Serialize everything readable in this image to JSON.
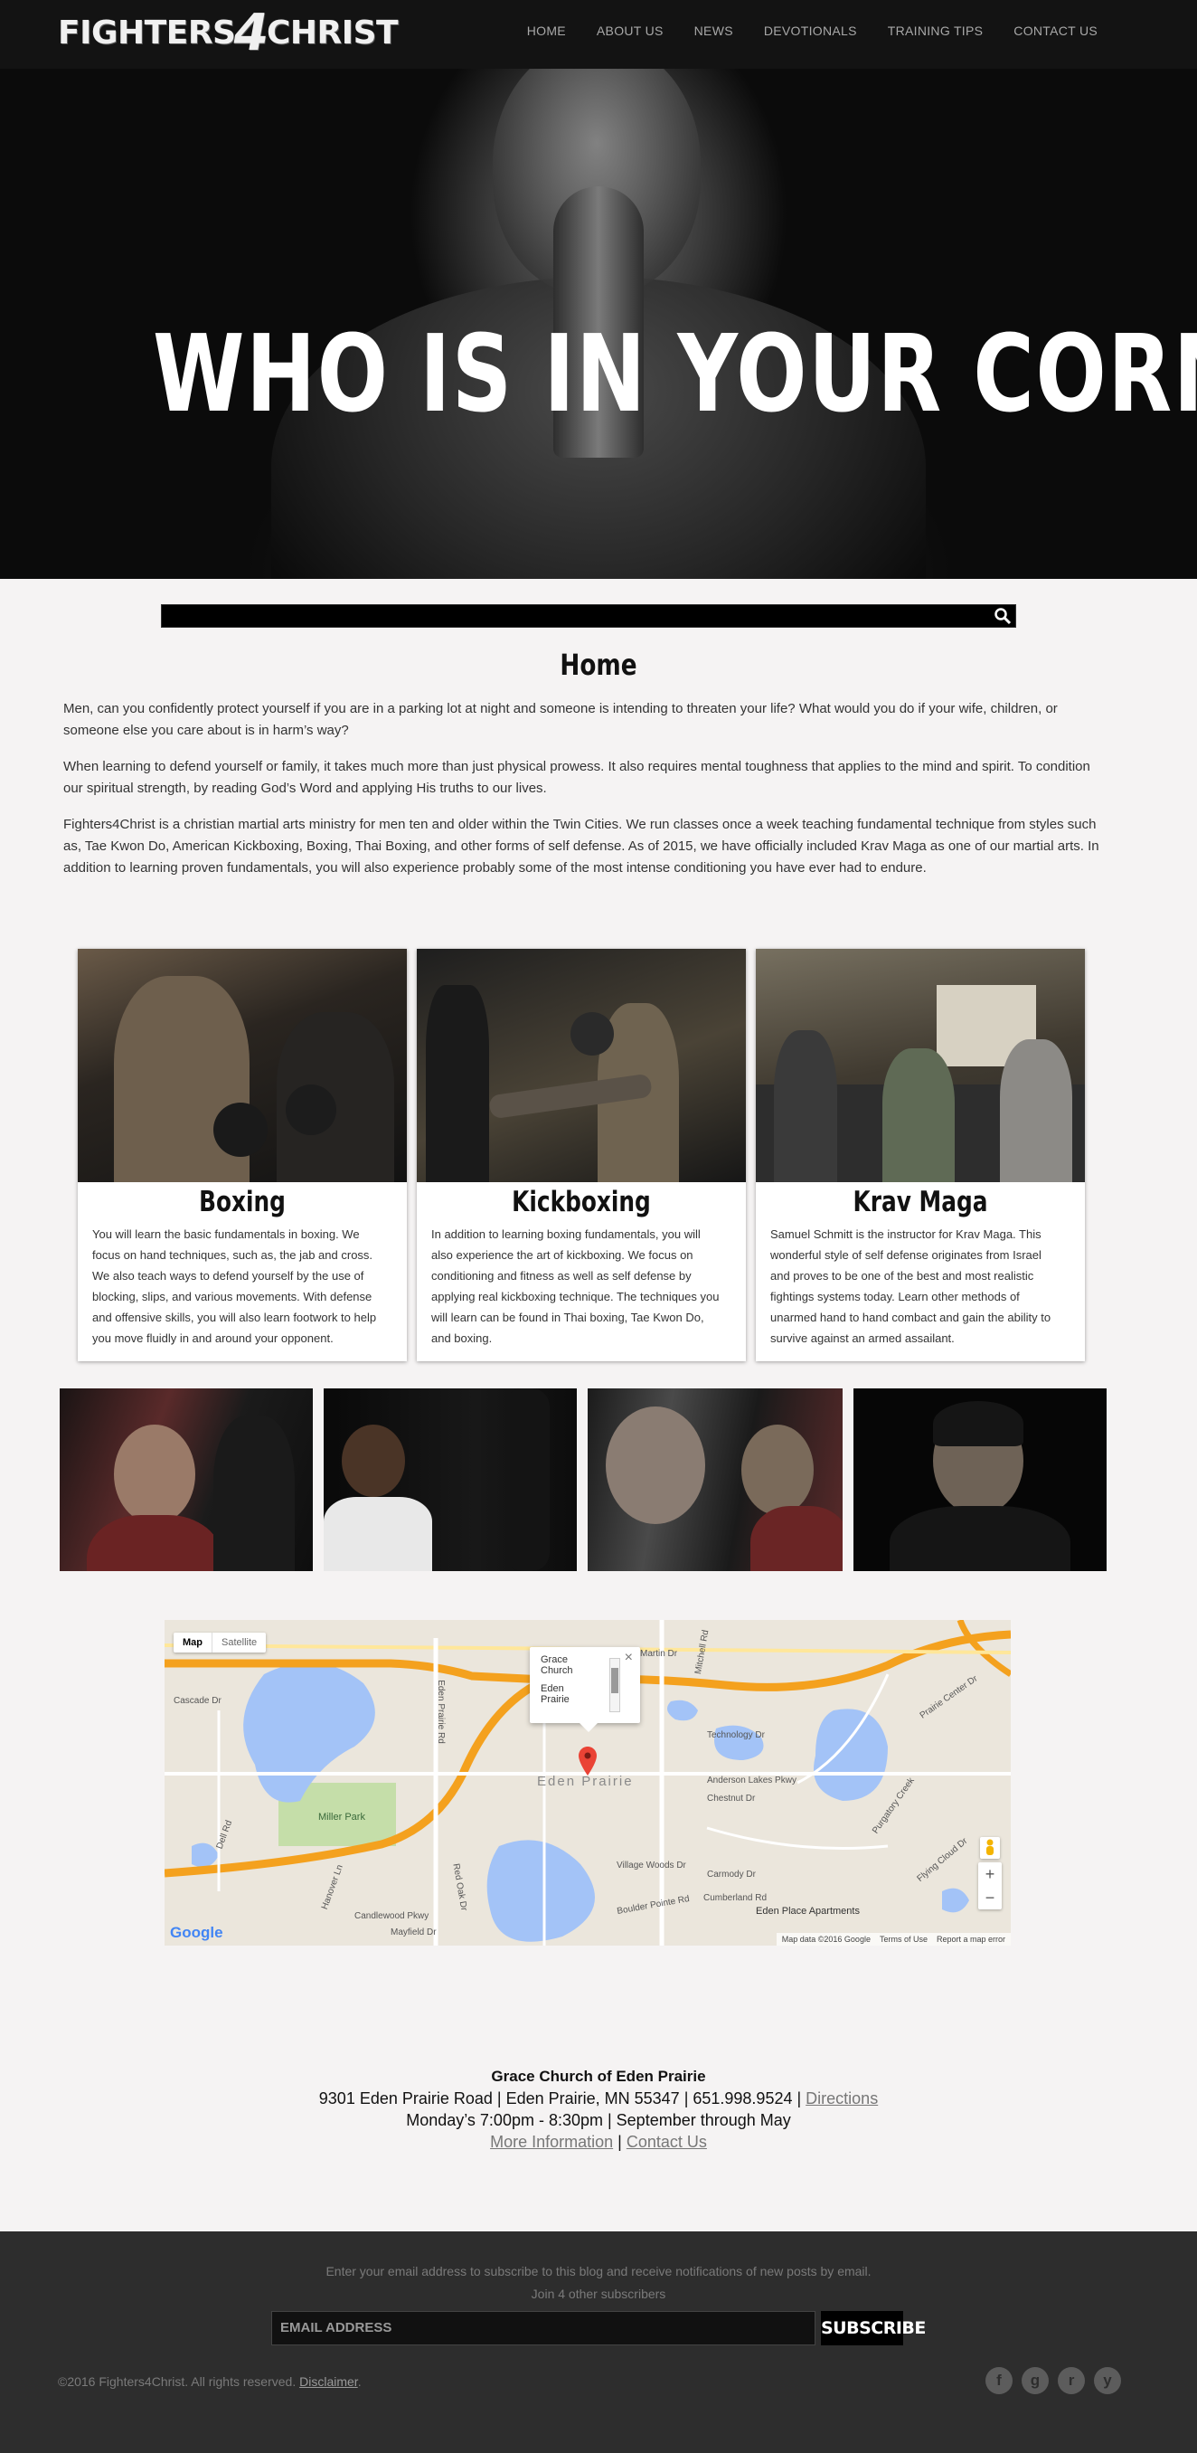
{
  "site": {
    "logo_text_a": "FIGHTERS",
    "logo_text_four": "4",
    "logo_text_b": "CHRIST"
  },
  "nav": {
    "items": [
      "HOME",
      "ABOUT US",
      "NEWS",
      "DEVOTIONALS",
      "TRAINING TIPS",
      "CONTACT US"
    ]
  },
  "hero": {
    "headline": "WHO IS IN YOUR CORNER?"
  },
  "search": {
    "placeholder": ""
  },
  "main": {
    "title": "Home",
    "paragraphs": [
      "Men, can you confidently protect yourself if you are in a parking lot at night and someone is intending to threaten your life? What would you do if your wife, children, or someone else you care about is in harm’s way?",
      "When learning to defend yourself or family, it takes much more than just physical prowess. It also requires mental toughness that applies to the mind and spirit. To condition our spiritual strength, by reading God’s Word and applying His truths to our lives.",
      "Fighters4Christ is a christian martial arts ministry for men ten and older within the Twin Cities.  We run classes once a week teaching fundamental technique from styles such as, Tae Kwon Do, American Kickboxing, Boxing, Thai Boxing, and other forms of self defense.  As of 2015, we have officially included Krav Maga as one of our martial arts.  In addition to learning proven fundamentals, you will also experience probably some of the most intense conditioning you have ever had to endure."
    ]
  },
  "cards": [
    {
      "title": "Boxing",
      "text": "You will learn the basic fundamentals in boxing. We focus on hand techniques, such as, the jab and cross. We also teach ways to defend yourself by the use of blocking, slips, and various movements. With defense and offensive skills, you will also learn footwork to help you move fluidly in and around your opponent."
    },
    {
      "title": "Kickboxing",
      "text": "In addition to learning boxing fundamentals, you will also experience the art of kickboxing. We focus on conditioning and fitness as well as self defense by applying real kickboxing technique. The techniques you will learn can be found in Thai boxing, Tae Kwon Do, and boxing."
    },
    {
      "title": "Krav Maga",
      "text": "Samuel Schmitt is the instructor for Krav Maga. This wonderful style of self defense originates from Israel and proves to be one of the best and most realistic fightings systems today. Learn other methods of unarmed hand to hand combact and gain the ability to survive against an armed assailant."
    }
  ],
  "map": {
    "type_map": "Map",
    "type_satellite": "Satellite",
    "info_line1": "Grace",
    "info_line2": "Church",
    "info_line3": "Eden",
    "info_line4": "Prairie",
    "city_label": "Eden Prairie",
    "place_labels": [
      "Miller Park",
      "Eden Place Apartments",
      "Technology Dr",
      "Anderson Lakes Pkwy",
      "Chestnut Dr",
      "Village Woods Dr",
      "Purgatory Creek",
      "Flying Cloud Dr",
      "Prairie Center Dr",
      "Eden Prairie Rd",
      "Mitchell Rd",
      "Carmody Dr",
      "Boulder Pointe Rd",
      "Cumberland Rd",
      "Candlewood Pkwy",
      "Mayfield Dr",
      "Hanover Ln",
      "Cascade Dr",
      "Red Oak Dr",
      "Dell Rd",
      "Martin Dr"
    ],
    "google": "Google",
    "footer_items": [
      "Map data ©2016 Google",
      "Terms of Use",
      "Report a map error"
    ],
    "zoom_in": "+",
    "zoom_out": "−"
  },
  "address": {
    "name": "Grace Church of Eden Prairie",
    "line": "9301 Eden Prairie Road | Eden Prairie, MN 55347 | 651.998.9524 |",
    "directions": "Directions",
    "schedule": "Monday’s 7:00pm - 8:30pm | September through May",
    "more_info": "More Information",
    "separator": "|",
    "contact": "Contact Us"
  },
  "footer": {
    "subscribe_text": "Enter your email address to subscribe to this blog and receive notifications of new posts by email.",
    "join_text": "Join 4 other subscribers",
    "email_placeholder": "EMAIL ADDRESS",
    "subscribe_button": "SUBSCRIBE",
    "copyright": "©2016 Fighters4Christ. All rights reserved.",
    "disclaimer": "Disclaimer",
    "period": ".",
    "socials": [
      "facebook-icon",
      "google-plus-icon",
      "rss-icon",
      "youtube-icon"
    ],
    "social_glyphs": [
      "f",
      "g",
      "r",
      "y"
    ]
  },
  "colors": {
    "footer_bg": "#2d2d2d",
    "page_bg": "#f5f3f3",
    "map_road": "#f4a11e",
    "map_water": "#a3c3f7",
    "map_park": "#c5dea9"
  }
}
